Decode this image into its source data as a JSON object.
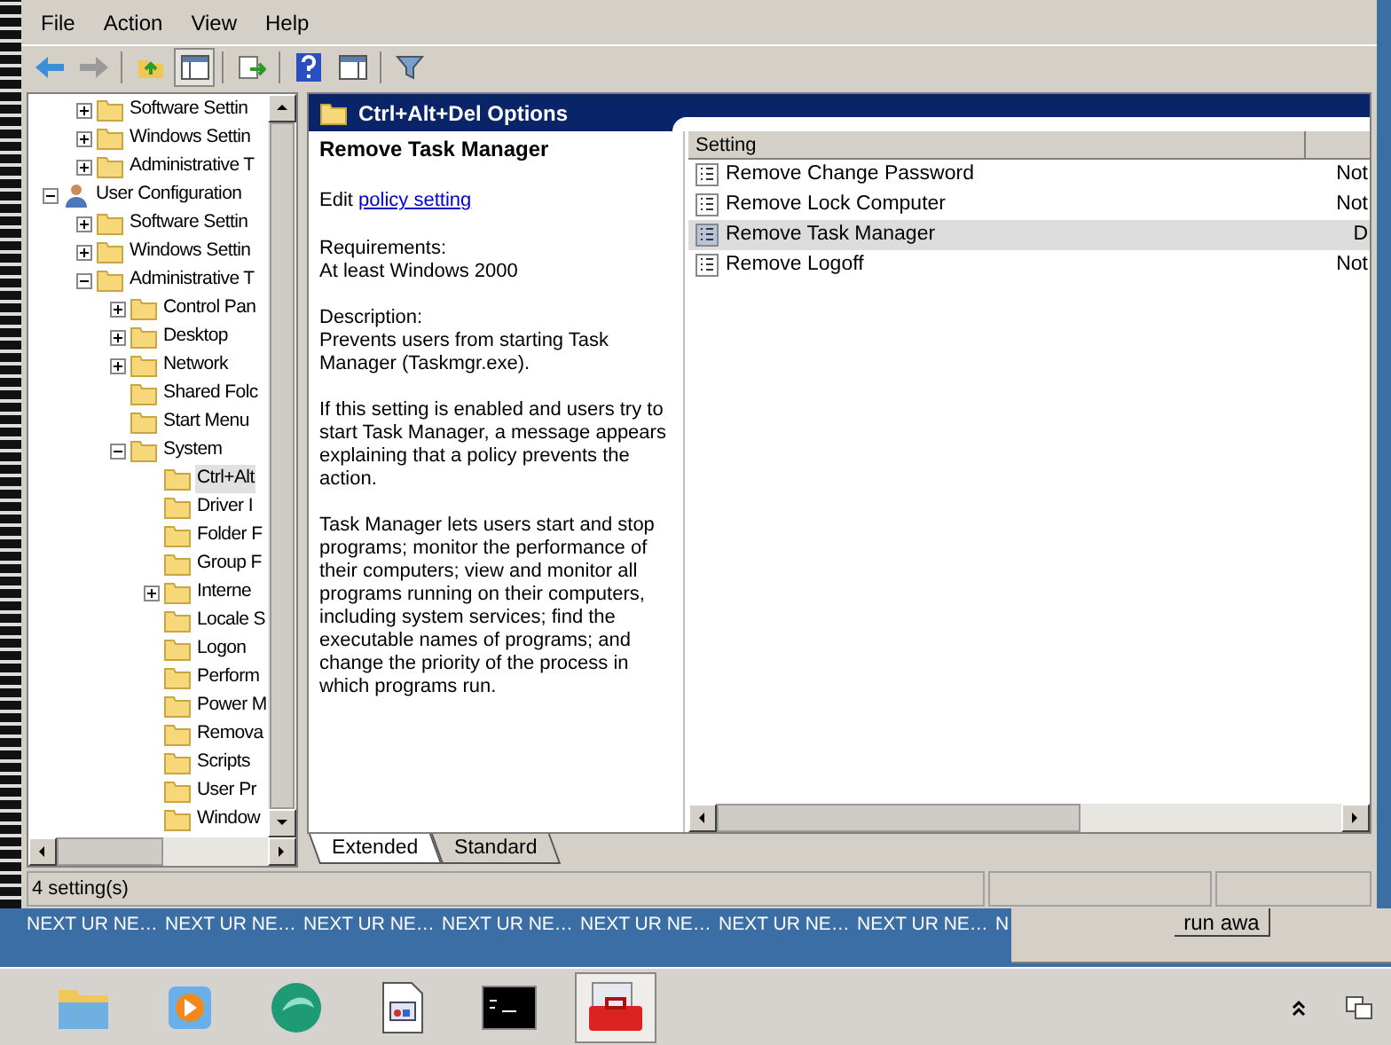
{
  "menu": [
    "File",
    "Action",
    "View",
    "Help"
  ],
  "tree": {
    "partial_children": [
      {
        "label": "Software Settin",
        "expanded": false,
        "selected": false
      },
      {
        "label": "Windows Settin",
        "expanded": false,
        "selected": false
      },
      {
        "label": "Administrative T",
        "expanded": false,
        "selected": false
      }
    ],
    "items": [
      {
        "label": "User Configuration",
        "kind": "user",
        "expanded": true,
        "selected": false,
        "children": [
          {
            "label": "Software Settin",
            "expanded": false,
            "selected": false
          },
          {
            "label": "Windows Settin",
            "expanded": false,
            "selected": false
          },
          {
            "label": "Administrative T",
            "expanded": true,
            "selected": false,
            "children": [
              {
                "label": "Control Pan",
                "expanded": false,
                "selected": false
              },
              {
                "label": "Desktop",
                "expanded": false,
                "selected": false
              },
              {
                "label": "Network",
                "expanded": false,
                "selected": false
              },
              {
                "label": "Shared Folc",
                "selected": false
              },
              {
                "label": "Start Menu",
                "selected": false
              },
              {
                "label": "System",
                "expanded": true,
                "selected": false,
                "children": [
                  {
                    "label": "Ctrl+Alt",
                    "selected": true
                  },
                  {
                    "label": "Driver I",
                    "selected": false
                  },
                  {
                    "label": "Folder F",
                    "selected": false
                  },
                  {
                    "label": "Group F",
                    "selected": false
                  },
                  {
                    "label": "Interne",
                    "expanded": false,
                    "selected": false
                  },
                  {
                    "label": "Locale S",
                    "selected": false
                  },
                  {
                    "label": "Logon",
                    "selected": false
                  },
                  {
                    "label": "Perform",
                    "selected": false
                  },
                  {
                    "label": "Power M",
                    "selected": false
                  },
                  {
                    "label": "Remova",
                    "selected": false
                  },
                  {
                    "label": "Scripts",
                    "selected": false
                  },
                  {
                    "label": "User Pr",
                    "selected": false
                  },
                  {
                    "label": "Window",
                    "selected": false
                  }
                ]
              }
            ]
          }
        ]
      }
    ]
  },
  "pane_title": "Ctrl+Alt+Del Options",
  "details": {
    "title": "Remove Task Manager",
    "edit_prefix": "Edit",
    "edit_link": "policy setting",
    "requirements_label": "Requirements:",
    "requirements": "At least Windows 2000",
    "description_label": "Description:",
    "paragraphs": [
      "Prevents users from starting Task Manager (Taskmgr.exe).",
      "If this setting is enabled and users try to start Task Manager, a message appears explaining that a policy prevents the action.",
      "Task Manager lets users start and stop programs; monitor the performance of their computers; view and monitor all programs running on their computers, including system services; find the executable names of programs; and change the priority of the process in which programs run."
    ]
  },
  "table": {
    "columns": [
      "Setting"
    ],
    "rows": [
      {
        "name": "Remove Change Password",
        "column_2": "Not",
        "selected": false
      },
      {
        "name": "Remove Lock Computer",
        "column_2": "Not",
        "selected": false
      },
      {
        "name": "Remove Task Manager",
        "column_2": "D",
        "selected": true
      },
      {
        "name": "Remove Logoff",
        "column_2": "Not",
        "selected": false
      }
    ]
  },
  "view_tabs": [
    {
      "label": "Extended",
      "selected": true
    },
    {
      "label": "Standard",
      "selected": false
    }
  ],
  "status_bar": "4 setting(s)",
  "desktop_labels": [
    "NEXT UR NE…",
    "NEXT UR NE…",
    "NEXT UR NE…",
    "NEXT UR NE…",
    "NEXT UR NE…",
    "NEXT UR NE…",
    "NEXT UR NE…",
    "N"
  ],
  "background_button": "run awa",
  "taskbar": {
    "apps": [
      {
        "kind": "folder",
        "active": false
      },
      {
        "kind": "media",
        "active": false
      },
      {
        "kind": "swirl",
        "active": false
      },
      {
        "kind": "document",
        "active": false
      },
      {
        "kind": "console",
        "active": false
      },
      {
        "kind": "toolbox",
        "active": true
      }
    ]
  }
}
